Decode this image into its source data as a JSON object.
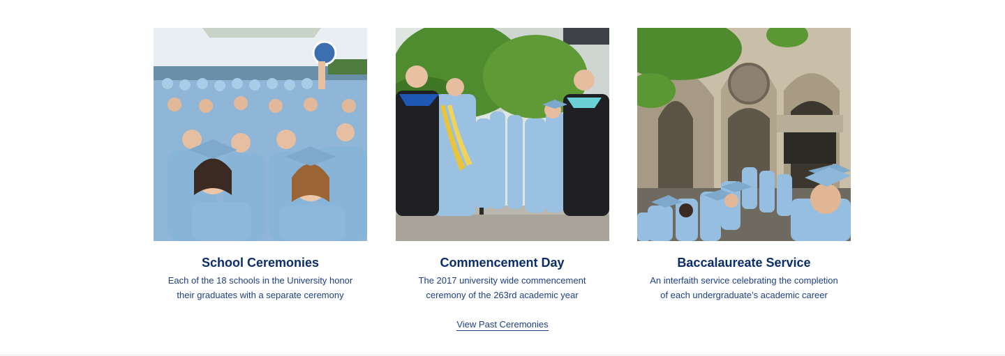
{
  "cards": [
    {
      "title": "School Ceremonies",
      "description_line1": "Each of the 18 schools in the University honor",
      "description_line2": "their graduates with a separate ceremony",
      "image": "graduates-cheering-photo"
    },
    {
      "title": "Commencement Day",
      "description_line1": "The 2017 university wide commencement",
      "description_line2": "ceremony of the 263rd academic year",
      "image": "graduates-procession-photo"
    },
    {
      "title": "Baccalaureate Service",
      "description_line1": "An interfaith service celebrating the completion",
      "description_line2": "of each undergraduate’s academic career",
      "image": "cathedral-steps-photo"
    }
  ],
  "past_link_label": "View Past Ceremonies",
  "colors": {
    "title": "#0b2d6b",
    "text": "#1d3f86",
    "gown": "#9cc3e4",
    "divider": "#e3e6ea"
  }
}
